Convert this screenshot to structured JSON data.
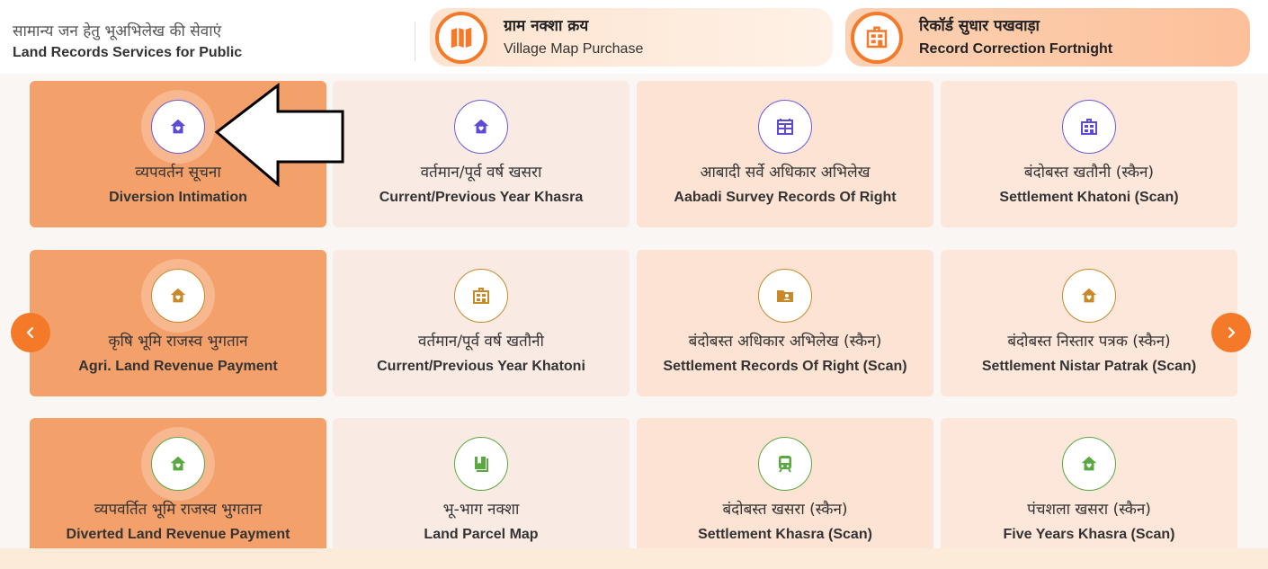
{
  "header": {
    "title_hi": "सामान्य जन हेतु भूअभिलेख की सेवाएं",
    "title_en": "Land Records Services for Public"
  },
  "quick_links": [
    {
      "hi": "ग्राम नक्शा क्रय",
      "en": "Village Map Purchase",
      "icon": "map-icon"
    },
    {
      "hi": "रिकॉर्ड सुधार पखवाड़ा",
      "en": "Record Correction Fortnight",
      "icon": "building-icon"
    }
  ],
  "cards": [
    {
      "hi": "व्यपवर्तन सूचना",
      "en": "Diversion Intimation",
      "icon": "home-heart-icon",
      "active": true
    },
    {
      "hi": "वर्तमान/पूर्व वर्ष खसरा",
      "en": "Current/Previous Year Khasra",
      "icon": "home-heart-icon"
    },
    {
      "hi": "आबादी सर्वे अधिकार अभिलेख",
      "en": "Aabadi Survey Records Of Right",
      "icon": "table-icon"
    },
    {
      "hi": "बंदोबस्त खतौनी (स्कैन)",
      "en": "Settlement Khatoni (Scan)",
      "icon": "building-icon"
    },
    {
      "hi": "कृषि भूमि राजस्व भुगतान",
      "en": "Agri. Land Revenue Payment",
      "icon": "home-heart-icon",
      "active": true
    },
    {
      "hi": "वर्तमान/पूर्व वर्ष खतौनी",
      "en": "Current/Previous Year Khatoni",
      "icon": "building-icon"
    },
    {
      "hi": "बंदोबस्त अधिकार अभिलेख (स्कैन)",
      "en": "Settlement Records Of Right (Scan)",
      "icon": "folder-user-icon"
    },
    {
      "hi": "बंदोबस्त निस्तार पत्रक (स्कैन)",
      "en": "Settlement Nistar Patrak (Scan)",
      "icon": "home-heart-icon"
    },
    {
      "hi": "व्यपवर्तित भूमि राजस्व भुगतान",
      "en": "Diverted Land Revenue Payment",
      "icon": "home-heart-icon",
      "active": true
    },
    {
      "hi": "भू-भाग नक्शा",
      "en": "Land Parcel Map",
      "icon": "book-icon"
    },
    {
      "hi": "बंदोबस्त खसरा (स्कैन)",
      "en": "Settlement Khasra (Scan)",
      "icon": "train-icon"
    },
    {
      "hi": "पंचशला खसरा (स्कैन)",
      "en": "Five Years Khasra (Scan)",
      "icon": "home-heart-icon"
    }
  ],
  "colors": {
    "accent": "#f47a2a",
    "icon_row1": "#5b4bd6",
    "icon_row2": "#c9892b",
    "icon_row3": "#5aa83f"
  }
}
